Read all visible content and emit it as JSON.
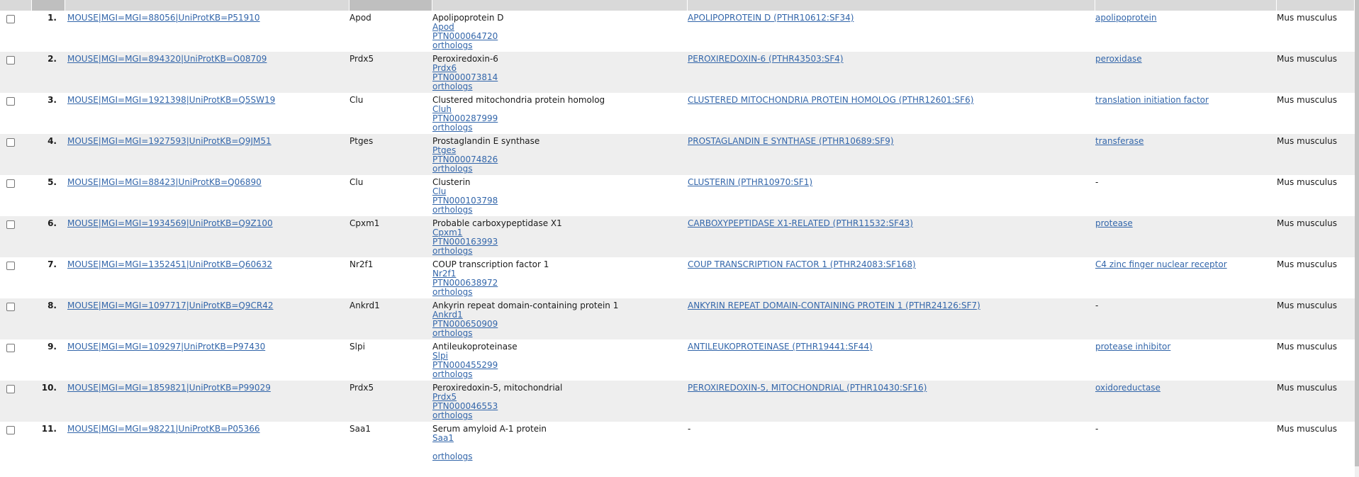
{
  "colors": {
    "header_bg": "#d9d9d9",
    "header_active_bg": "#bfbfbf",
    "row_alt_bg": "#eeeeee",
    "link": "#3366aa"
  },
  "rows": [
    {
      "num": "1.",
      "gene_id": "MOUSE|MGI=MGI=88056|UniProtKB=P51910",
      "symbol": "Apod",
      "name": "Apolipoprotein D",
      "sym_link": "Apod",
      "ptn": "PTN000064720",
      "orthologs": "orthologs",
      "family": "APOLIPOPROTEIN D (PTHR10612:SF34)",
      "pclass": "apolipoprotein",
      "species": "Mus musculus"
    },
    {
      "num": "2.",
      "gene_id": "MOUSE|MGI=MGI=894320|UniProtKB=O08709",
      "symbol": "Prdx5",
      "name": "Peroxiredoxin-6",
      "sym_link": "Prdx6",
      "ptn": "PTN000073814",
      "orthologs": "orthologs",
      "family": "PEROXIREDOXIN-6 (PTHR43503:SF4)",
      "pclass": "peroxidase",
      "species": "Mus musculus"
    },
    {
      "num": "3.",
      "gene_id": "MOUSE|MGI=MGI=1921398|UniProtKB=Q5SW19",
      "symbol": "Clu",
      "name": "Clustered mitochondria protein homolog",
      "sym_link": "Cluh",
      "ptn": "PTN000287999",
      "orthologs": "orthologs",
      "family": "CLUSTERED MITOCHONDRIA PROTEIN HOMOLOG (PTHR12601:SF6)",
      "pclass": "translation initiation factor",
      "species": "Mus musculus"
    },
    {
      "num": "4.",
      "gene_id": "MOUSE|MGI=MGI=1927593|UniProtKB=Q9JM51",
      "symbol": "Ptges",
      "name": "Prostaglandin E synthase",
      "sym_link": "Ptges",
      "ptn": "PTN000074826",
      "orthologs": "orthologs",
      "family": "PROSTAGLANDIN E SYNTHASE (PTHR10689:SF9)",
      "pclass": "transferase",
      "species": "Mus musculus"
    },
    {
      "num": "5.",
      "gene_id": "MOUSE|MGI=MGI=88423|UniProtKB=Q06890",
      "symbol": "Clu",
      "name": "Clusterin",
      "sym_link": "Clu",
      "ptn": "PTN000103798",
      "orthologs": "orthologs",
      "family": "CLUSTERIN (PTHR10970:SF1)",
      "pclass": "-",
      "species": "Mus musculus"
    },
    {
      "num": "6.",
      "gene_id": "MOUSE|MGI=MGI=1934569|UniProtKB=Q9Z100",
      "symbol": "Cpxm1",
      "name": "Probable carboxypeptidase X1",
      "sym_link": "Cpxm1",
      "ptn": "PTN000163993",
      "orthologs": "orthologs",
      "family": "CARBOXYPEPTIDASE X1-RELATED (PTHR11532:SF43)",
      "pclass": "protease",
      "species": "Mus musculus"
    },
    {
      "num": "7.",
      "gene_id": "MOUSE|MGI=MGI=1352451|UniProtKB=Q60632",
      "symbol": "Nr2f1",
      "name": "COUP transcription factor 1",
      "sym_link": "Nr2f1",
      "ptn": "PTN000638972",
      "orthologs": "orthologs",
      "family": "COUP TRANSCRIPTION FACTOR 1 (PTHR24083:SF168)",
      "pclass": "C4 zinc finger nuclear receptor",
      "species": "Mus musculus"
    },
    {
      "num": "8.",
      "gene_id": "MOUSE|MGI=MGI=1097717|UniProtKB=Q9CR42",
      "symbol": "Ankrd1",
      "name": "Ankyrin repeat domain-containing protein 1",
      "sym_link": "Ankrd1",
      "ptn": "PTN000650909",
      "orthologs": "orthologs",
      "family": "ANKYRIN REPEAT DOMAIN-CONTAINING PROTEIN 1 (PTHR24126:SF7)",
      "pclass": "-",
      "species": "Mus musculus"
    },
    {
      "num": "9.",
      "gene_id": "MOUSE|MGI=MGI=109297|UniProtKB=P97430",
      "symbol": "Slpi",
      "name": "Antileukoproteinase",
      "sym_link": "Slpi",
      "ptn": "PTN000455299",
      "orthologs": "orthologs",
      "family": "ANTILEUKOPROTEINASE (PTHR19441:SF44)",
      "pclass": "protease inhibitor",
      "species": "Mus musculus"
    },
    {
      "num": "10.",
      "gene_id": "MOUSE|MGI=MGI=1859821|UniProtKB=P99029",
      "symbol": "Prdx5",
      "name": "Peroxiredoxin-5, mitochondrial",
      "sym_link": "Prdx5",
      "ptn": "PTN000046553",
      "orthologs": "orthologs",
      "family": "PEROXIREDOXIN-5, MITOCHONDRIAL (PTHR10430:SF16)",
      "pclass": "oxidoreductase",
      "species": "Mus musculus"
    },
    {
      "num": "11.",
      "gene_id": "MOUSE|MGI=MGI=98221|UniProtKB=P05366",
      "symbol": "Saa1",
      "name": "Serum amyloid A-1 protein",
      "sym_link": "Saa1",
      "ptn": "",
      "orthologs": "orthologs",
      "family": "-",
      "pclass": "-",
      "species": "Mus musculus"
    }
  ]
}
